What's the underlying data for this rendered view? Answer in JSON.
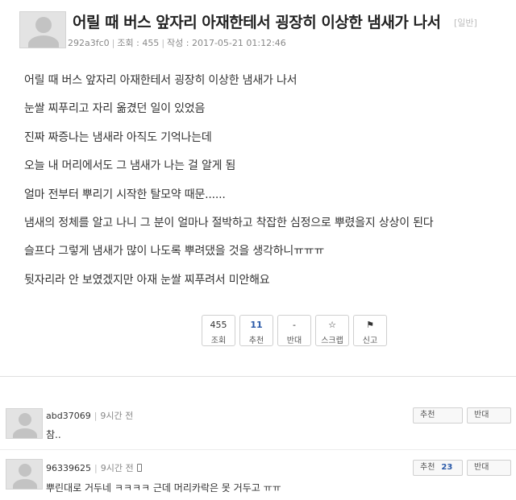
{
  "post": {
    "title": "어릴 때 버스 앞자리 아재한테서 굉장히 이상한 냄새가 나서",
    "category": "[일반]",
    "author": "292a3fc0",
    "views_label": "조회 : 455",
    "date_label": "작성 : 2017-05-21 01:12:46",
    "lines": [
      "어릴 때 버스 앞자리 아재한테서 굉장히 이상한 냄새가 나서",
      "눈쌀 찌푸리고 자리 옮겼던 일이 있었음",
      "진짜 짜증나는 냄새라 아직도 기억나는데",
      "오늘 내 머리에서도 그 냄새가 나는 걸 알게 됨",
      "얼마 전부터 뿌리기 시작한 탈모약 때문......",
      "냄새의 정체를 알고 나니 그 분이 얼마나 절박하고 착잡한 심정으로 뿌렸을지 상상이 된다",
      "슬프다 그렇게 냄새가 많이 나도록 뿌려댔을 것을 생각하니ㅠㅠㅠ",
      "뒷자리라 안 보였겠지만 아재 눈쌀 찌푸려서 미안해요"
    ]
  },
  "actions": {
    "views": {
      "num": "455",
      "label": "조회"
    },
    "recommend": {
      "num": "11",
      "label": "추천"
    },
    "oppose": {
      "num": "-",
      "label": "반대"
    },
    "scrap": {
      "label": "스크랩"
    },
    "report": {
      "label": "신고"
    }
  },
  "comments": [
    {
      "user": "abd37069",
      "time": "9시간 전",
      "text": "참..",
      "up_label": "추천",
      "up_count": "",
      "down_label": "반대",
      "mobile": false
    },
    {
      "user": "96339625",
      "time": "9시간 전",
      "text": "뿌린대로 거두네 ㅋㅋㅋㅋ 근데 머리카락은 못 거두고 ㅠㅠ",
      "up_label": "추천",
      "up_count": "23",
      "down_label": "반대",
      "mobile": true
    }
  ]
}
